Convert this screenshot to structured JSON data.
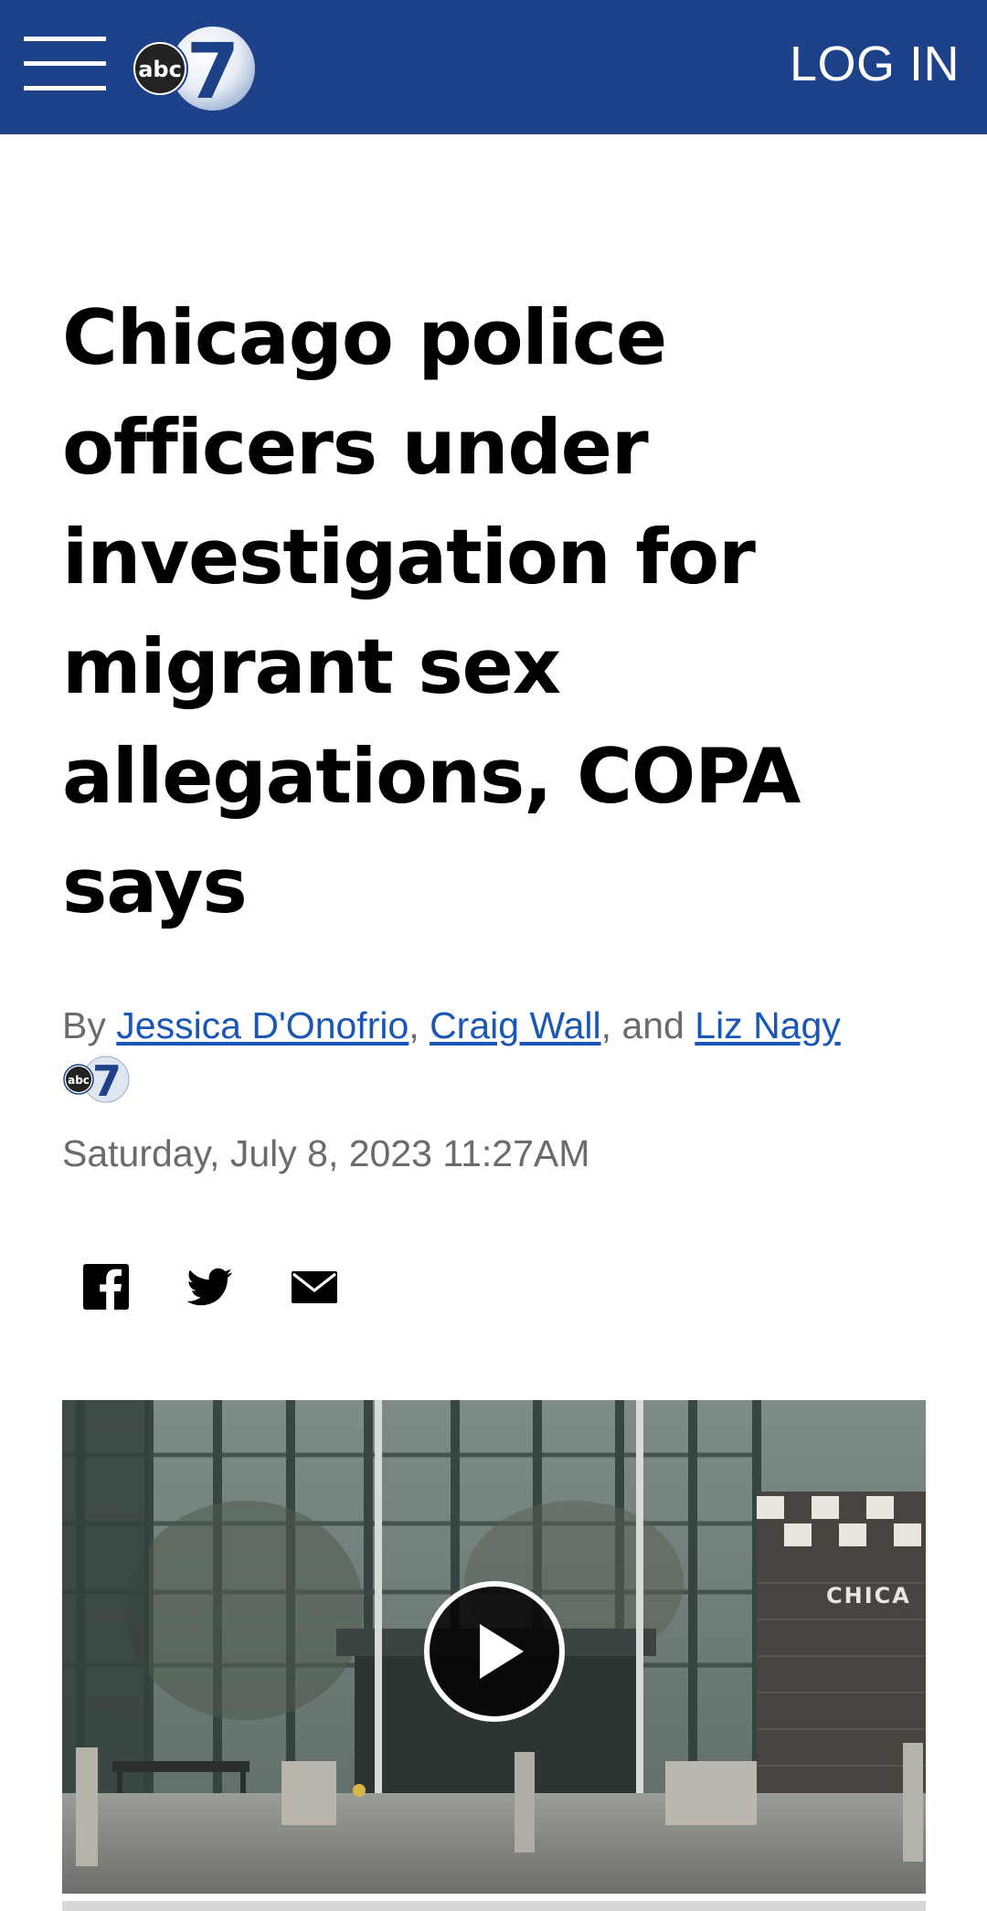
{
  "header": {
    "login_label": "LOG IN",
    "logo_text": "abc",
    "logo_number": "7",
    "brand_color": "#1d428a"
  },
  "article": {
    "headline_lines": [
      "Chicago police",
      "officers under",
      "investigation for",
      "migrant sex",
      "allegations, COPA",
      "says"
    ],
    "byline": {
      "by": "By",
      "author1": "Jessica D'Onofrio",
      "sep1": ",",
      "author2": "Craig Wall",
      "sep2": ", and",
      "author3": "Liz Nagy"
    },
    "date": "Saturday, July 8, 2023 11:27AM"
  },
  "share": {
    "icons": [
      "facebook-icon",
      "twitter-icon",
      "email-icon"
    ]
  },
  "video": {
    "sign_text": "CHICA",
    "play_icon": "play-icon"
  },
  "colors": {
    "link": "#1a56b8",
    "meta_text": "#6b6b6b"
  }
}
